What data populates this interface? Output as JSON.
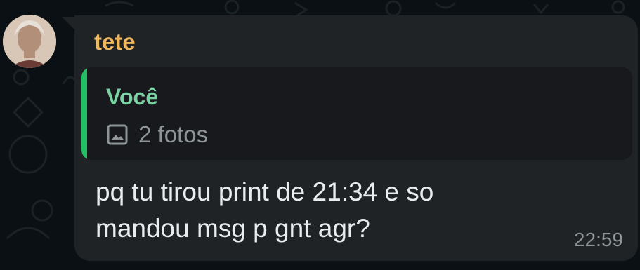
{
  "message": {
    "sender_name": "tete",
    "quote": {
      "author": "Você",
      "media_icon": "image-icon",
      "media_label": "2 fotos"
    },
    "text": "pq tu tirou print de 21:34 e so\nmandou msg p gnt agr?",
    "time": "22:59"
  },
  "colors": {
    "background": "#0b1014",
    "bubble": "#1f2326",
    "quote_background": "#17191c",
    "quote_bar": "#21c063",
    "sender_name": "#f0b85b",
    "quote_author": "#7bd3a4",
    "message_text": "#e9edef",
    "muted_text": "#8d9599"
  }
}
